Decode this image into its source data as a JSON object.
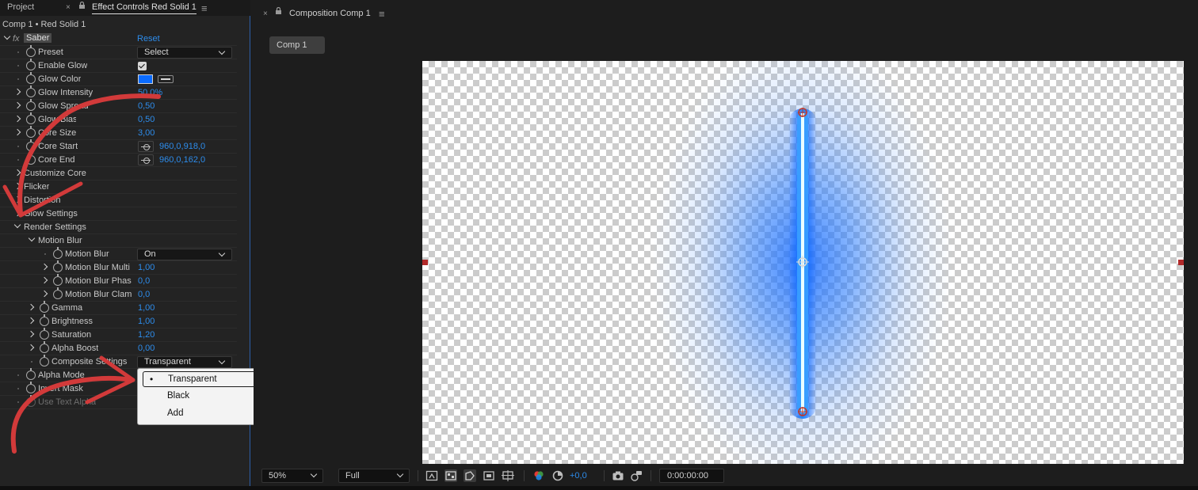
{
  "left_panel": {
    "tabs": {
      "project": "Project",
      "effect_controls": "Effect Controls Red Solid 1"
    },
    "comp_title": "Comp 1 • Red Solid 1",
    "effect": {
      "fx": "fx",
      "name": "Saber",
      "reset": "Reset"
    },
    "props": {
      "preset": {
        "label": "Preset",
        "value": "Select"
      },
      "enable_glow": {
        "label": "Enable Glow",
        "checked": true
      },
      "glow_color": {
        "label": "Glow Color",
        "color": "#0a6bff"
      },
      "glow_intensity": {
        "label": "Glow Intensity",
        "value": "50,0%"
      },
      "glow_spread": {
        "label": "Glow Spread",
        "value": "0,50"
      },
      "glow_bias": {
        "label": "Glow Bias",
        "value": "0,50"
      },
      "core_size": {
        "label": "Core Size",
        "value": "3,00"
      },
      "core_start": {
        "label": "Core Start",
        "value": "960,0,918,0"
      },
      "core_end": {
        "label": "Core End",
        "value": "960,0,162,0"
      },
      "customize_core": {
        "label": "Customize Core"
      },
      "flicker": {
        "label": "Flicker"
      },
      "distortion": {
        "label": "Distortion"
      },
      "glow_settings": {
        "label": "Glow Settings"
      },
      "render_settings": {
        "label": "Render Settings"
      },
      "motion_blur_group": {
        "label": "Motion Blur"
      },
      "motion_blur": {
        "label": "Motion Blur",
        "value": "On"
      },
      "motion_blur_multi": {
        "label": "Motion Blur Multi",
        "value": "1,00"
      },
      "motion_blur_phase": {
        "label": "Motion Blur Phas",
        "value": "0,0"
      },
      "motion_blur_clamp": {
        "label": "Motion Blur Clam",
        "value": "0,0"
      },
      "gamma": {
        "label": "Gamma",
        "value": "1,00"
      },
      "brightness": {
        "label": "Brightness",
        "value": "1,00"
      },
      "saturation": {
        "label": "Saturation",
        "value": "1,20"
      },
      "alpha_boost": {
        "label": "Alpha Boost",
        "value": "0,00"
      },
      "composite_settings": {
        "label": "Composite Settings",
        "value": "Transparent"
      },
      "alpha_mode": {
        "label": "Alpha Mode"
      },
      "invert_mask": {
        "label": "Invert Mask"
      },
      "use_text_alpha": {
        "label": "Use Text Alpha"
      }
    },
    "popup": {
      "options": [
        "Transparent",
        "Black",
        "Add"
      ],
      "selected": "Transparent",
      "bullet": "•"
    }
  },
  "right_panel": {
    "tab_title": "Composition Comp 1",
    "comp_button": "Comp 1",
    "bottom": {
      "zoom": "50%",
      "resolution": "Full",
      "exposure": "+0,0",
      "timecode": "0:00:00:00"
    }
  },
  "glyphs": {
    "close": "×",
    "menu": "≡",
    "lock": "ᵖ"
  },
  "colors": {
    "value_blue": "#2d8ceb",
    "saber_glow": "#0a6bff",
    "arrow_red": "#d23a3a",
    "panel_focus": "#2c5fa8"
  },
  "icons": [
    "close-icon",
    "lock-icon",
    "panel-menu-icon",
    "stopwatch-icon",
    "eyedropper-icon",
    "crosshair-icon",
    "color-channels-icon",
    "reset-exposure-icon",
    "snapshot-icon",
    "show-snapshot-icon",
    "transparency-grid-icon",
    "region-of-interest-icon",
    "mask-visibility-icon",
    "guides-icon"
  ]
}
